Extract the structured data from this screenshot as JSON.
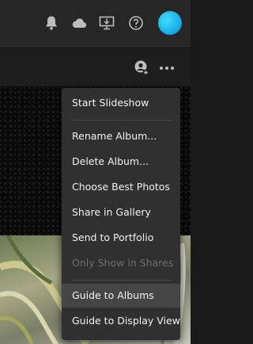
{
  "top_toolbar": {
    "icons": [
      "bell-icon",
      "cloud-icon",
      "present-icon",
      "help-icon"
    ],
    "avatar_color": "#1cb4ea"
  },
  "album_toolbar": {
    "icons": [
      "add-person-icon",
      "more-options-icon"
    ]
  },
  "menu": {
    "items": [
      {
        "label": "Start Slideshow",
        "state": "enabled"
      },
      {
        "label": "Rename Album...",
        "state": "enabled"
      },
      {
        "label": "Delete Album...",
        "state": "enabled"
      },
      {
        "label": "Choose Best Photos",
        "state": "enabled"
      },
      {
        "label": "Share in Gallery",
        "state": "enabled"
      },
      {
        "label": "Send to Portfolio",
        "state": "enabled"
      },
      {
        "label": "Only Show in Shares",
        "state": "disabled"
      },
      {
        "label": "Guide to Albums",
        "state": "highlighted"
      },
      {
        "label": "Guide to Display View",
        "state": "enabled"
      }
    ]
  },
  "colors": {
    "menu_background": "#303030",
    "menu_highlight": "#454545",
    "disabled_text": "#6e6e6e",
    "avatar": "#1cb4ea"
  }
}
